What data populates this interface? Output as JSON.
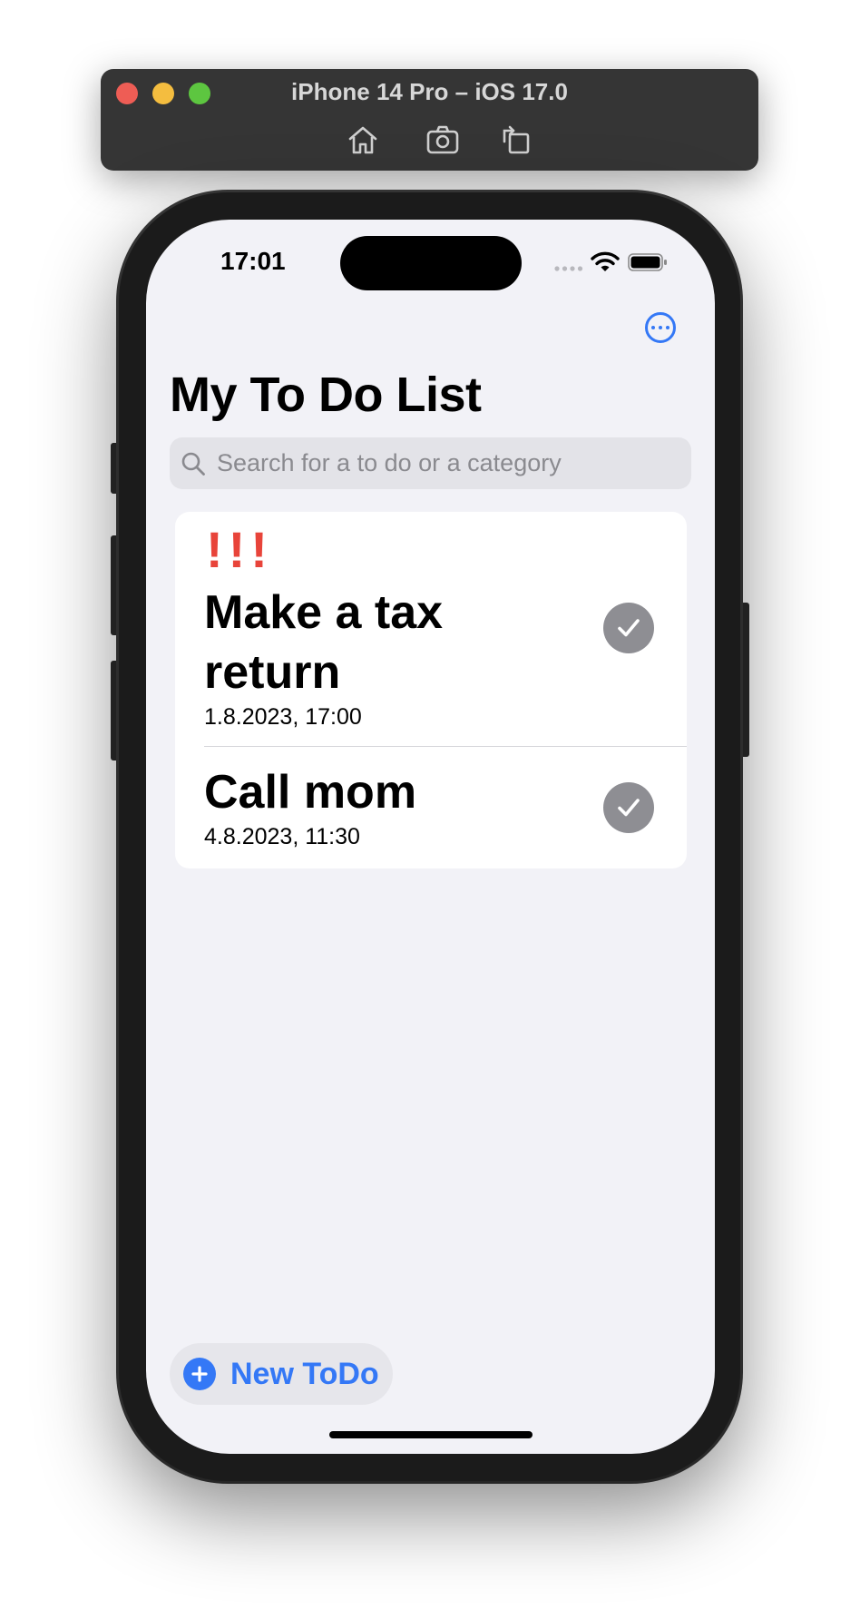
{
  "simulator": {
    "title": "iPhone 14 Pro – iOS 17.0",
    "toolbar": [
      "home-icon",
      "screenshot-icon",
      "rotate-icon"
    ]
  },
  "status_bar": {
    "time": "17:01"
  },
  "nav": {
    "more_icon": "ellipsis-circle-icon",
    "title": "My To Do List"
  },
  "search": {
    "placeholder": "Search for a to do or a category",
    "value": ""
  },
  "todos": [
    {
      "priority": "!!!",
      "title": "Make a tax return",
      "date": "1.8.2023, 17:00",
      "done": false
    },
    {
      "priority": "",
      "title": "Call mom",
      "date": "4.8.2023, 11:30",
      "done": false
    }
  ],
  "new_todo": {
    "label": "New ToDo"
  },
  "colors": {
    "accent": "#3478f6",
    "priority": "#e8443a",
    "check": "#8e8e93",
    "background": "#f2f2f7"
  }
}
